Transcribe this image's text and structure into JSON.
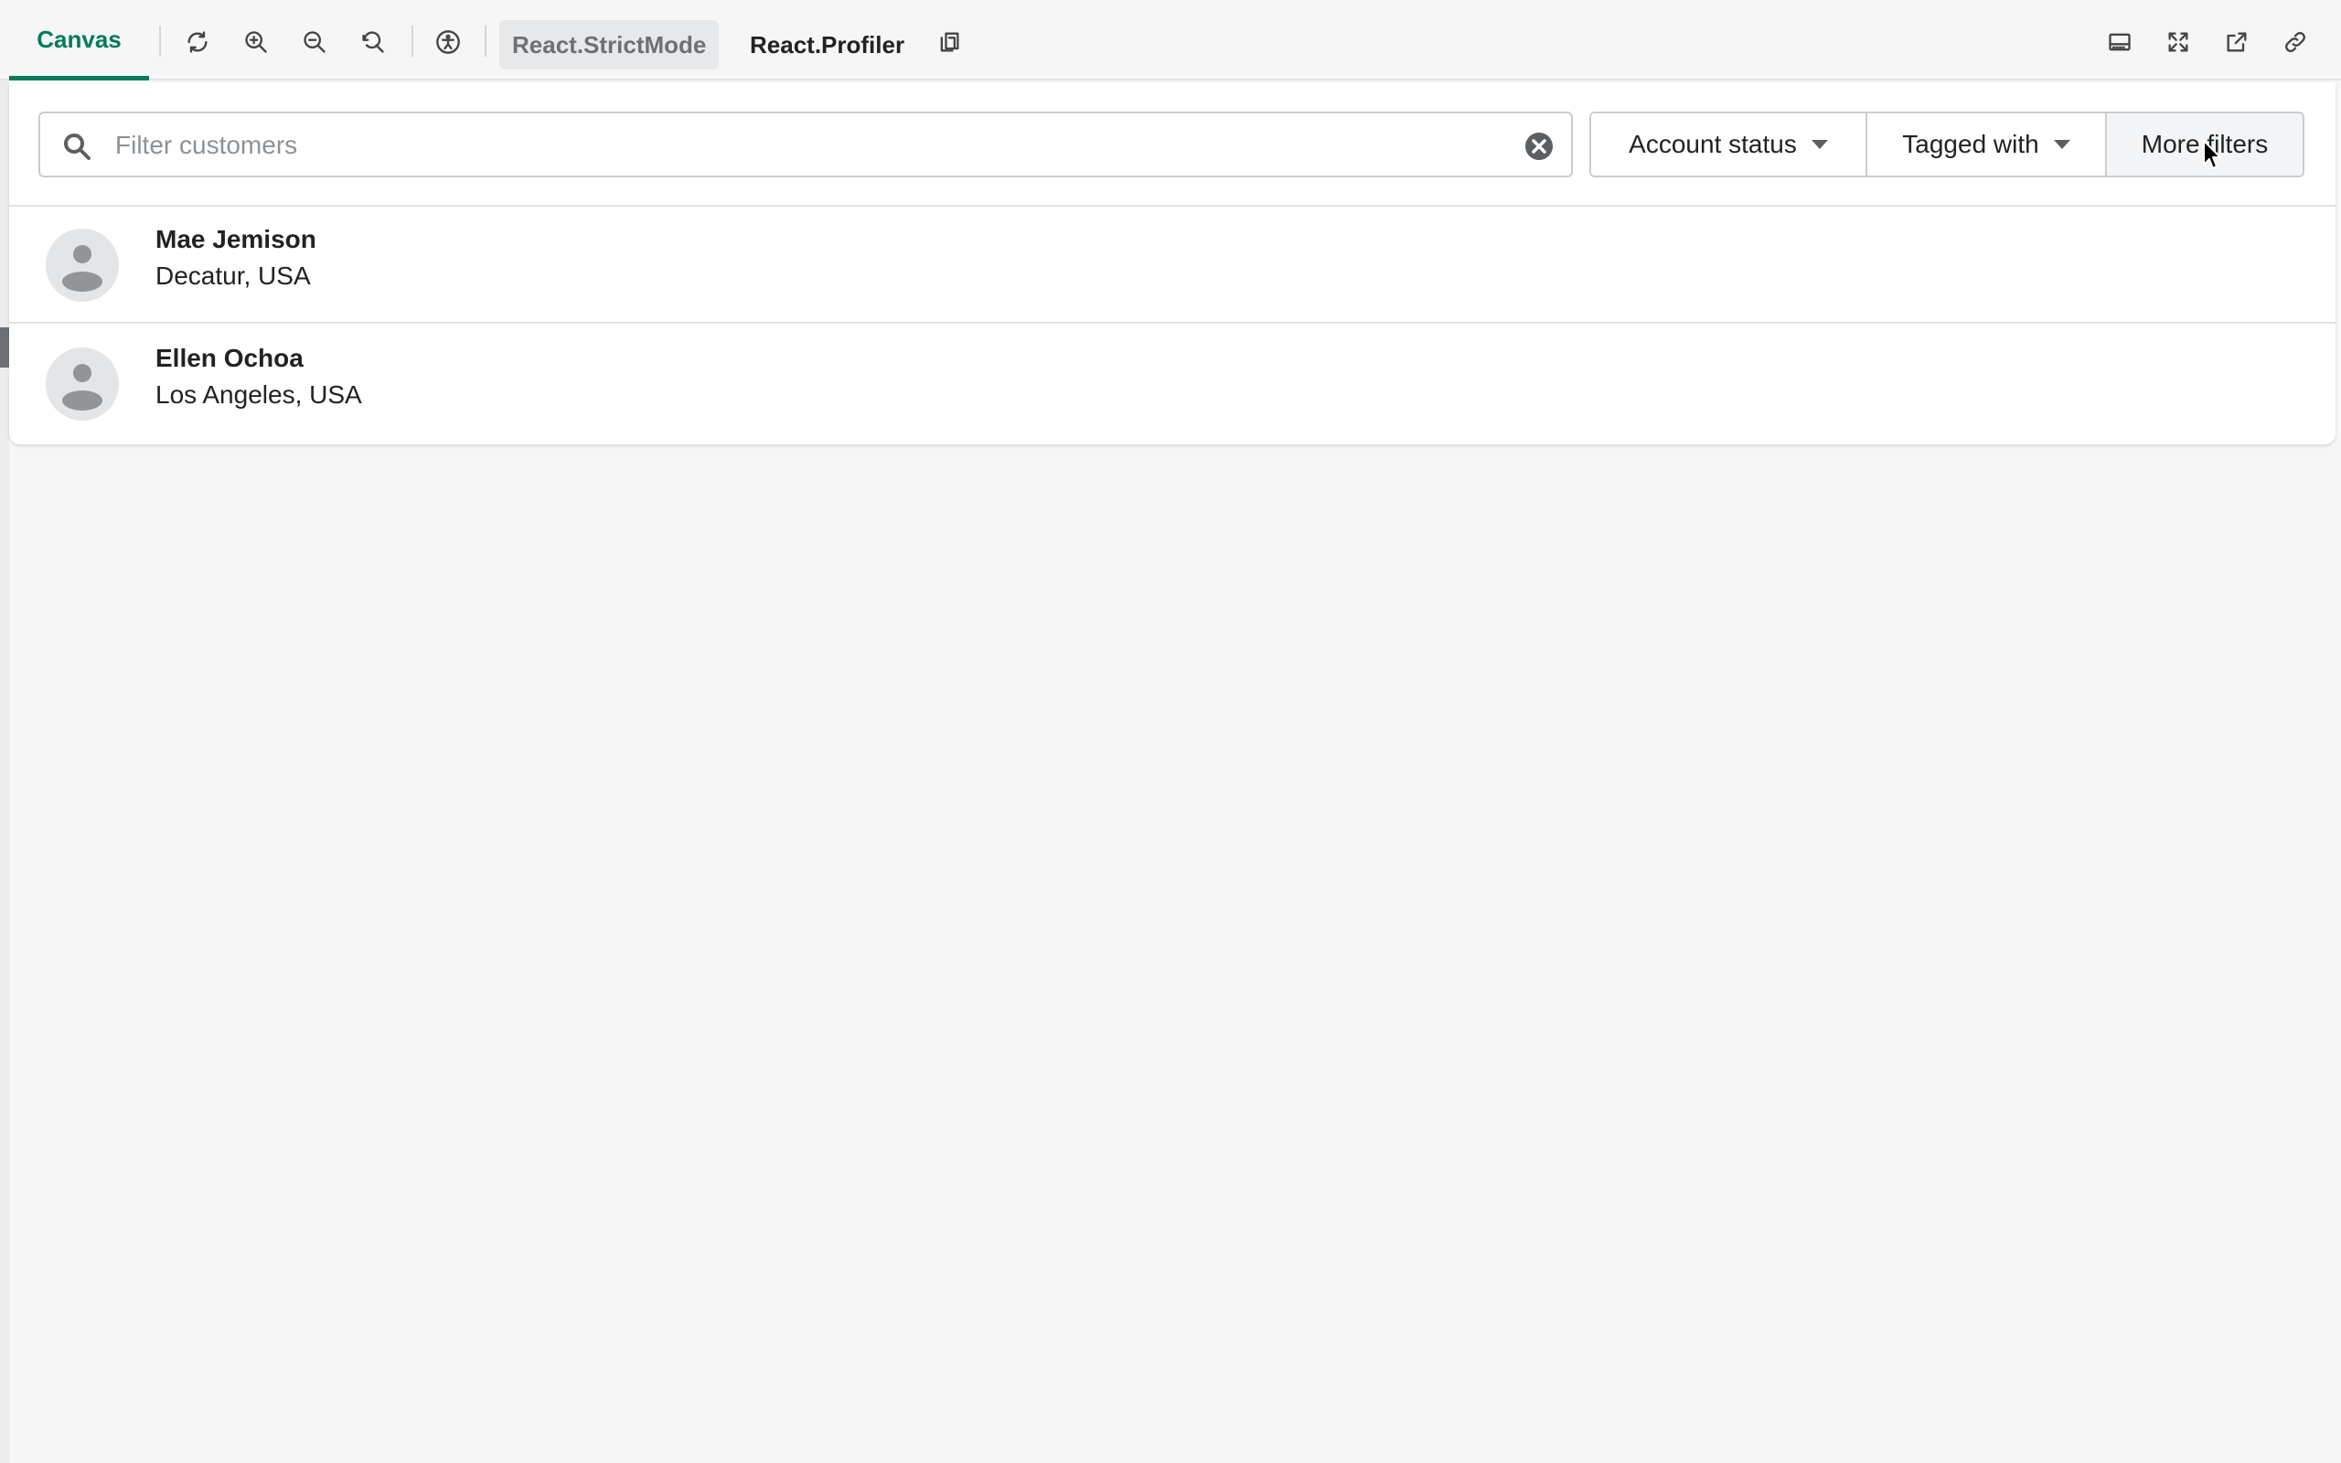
{
  "toolbar": {
    "canvas_tab": "Canvas",
    "tools": [
      {
        "icon": "refresh-icon"
      },
      {
        "icon": "zoom-in-icon"
      },
      {
        "icon": "zoom-out-icon"
      },
      {
        "icon": "reset-zoom-icon"
      },
      {
        "icon": "accessibility-icon"
      }
    ],
    "strict_mode_label": "React.StrictMode",
    "profiler_label": "React.Profiler",
    "right_tools": [
      {
        "icon": "panel-bottom-icon"
      },
      {
        "icon": "fullscreen-icon"
      },
      {
        "icon": "open-new-tab-icon"
      },
      {
        "icon": "link-icon"
      }
    ]
  },
  "filters": {
    "search_placeholder": "Filter customers",
    "search_value": "",
    "account_status_label": "Account status",
    "tagged_with_label": "Tagged with",
    "more_filters_label": "More filters"
  },
  "customers": [
    {
      "name": "Mae Jemison",
      "location": "Decatur, USA"
    },
    {
      "name": "Ellen Ochoa",
      "location": "Los Angeles, USA"
    }
  ],
  "colors": {
    "accent": "#007b5c",
    "background": "#f6f6f6",
    "border": "#c9cccf"
  }
}
